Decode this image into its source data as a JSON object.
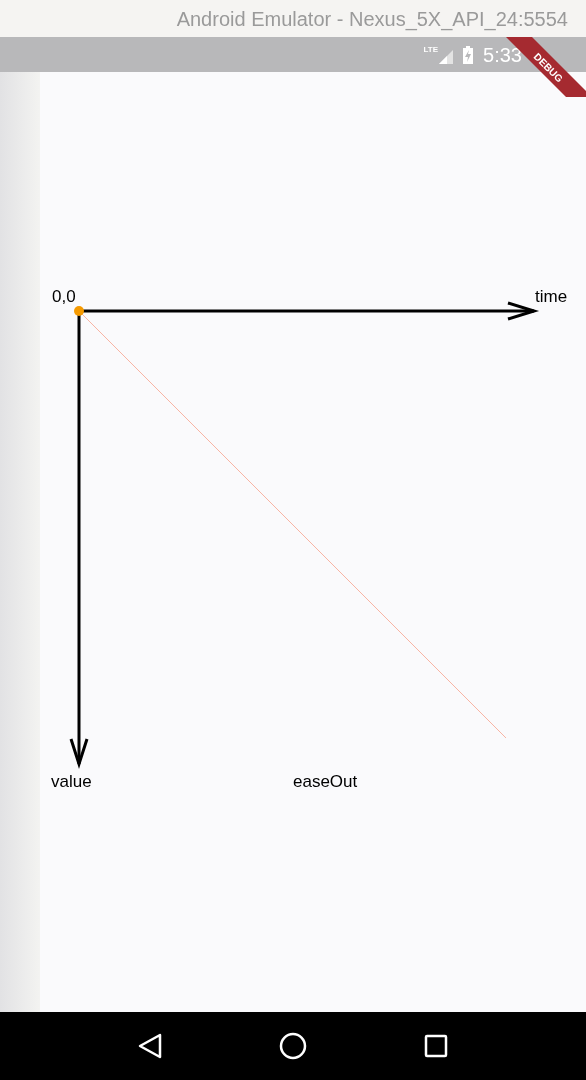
{
  "window": {
    "title": "Android Emulator - Nexus_5X_API_24:5554"
  },
  "status_bar": {
    "network": "LTE",
    "time": "5:33"
  },
  "debug_banner": "DEBUG",
  "curve_plot": {
    "origin_label": "0,0",
    "x_axis_label": "time",
    "y_axis_label": "value",
    "curve_name": "easeOut"
  }
}
